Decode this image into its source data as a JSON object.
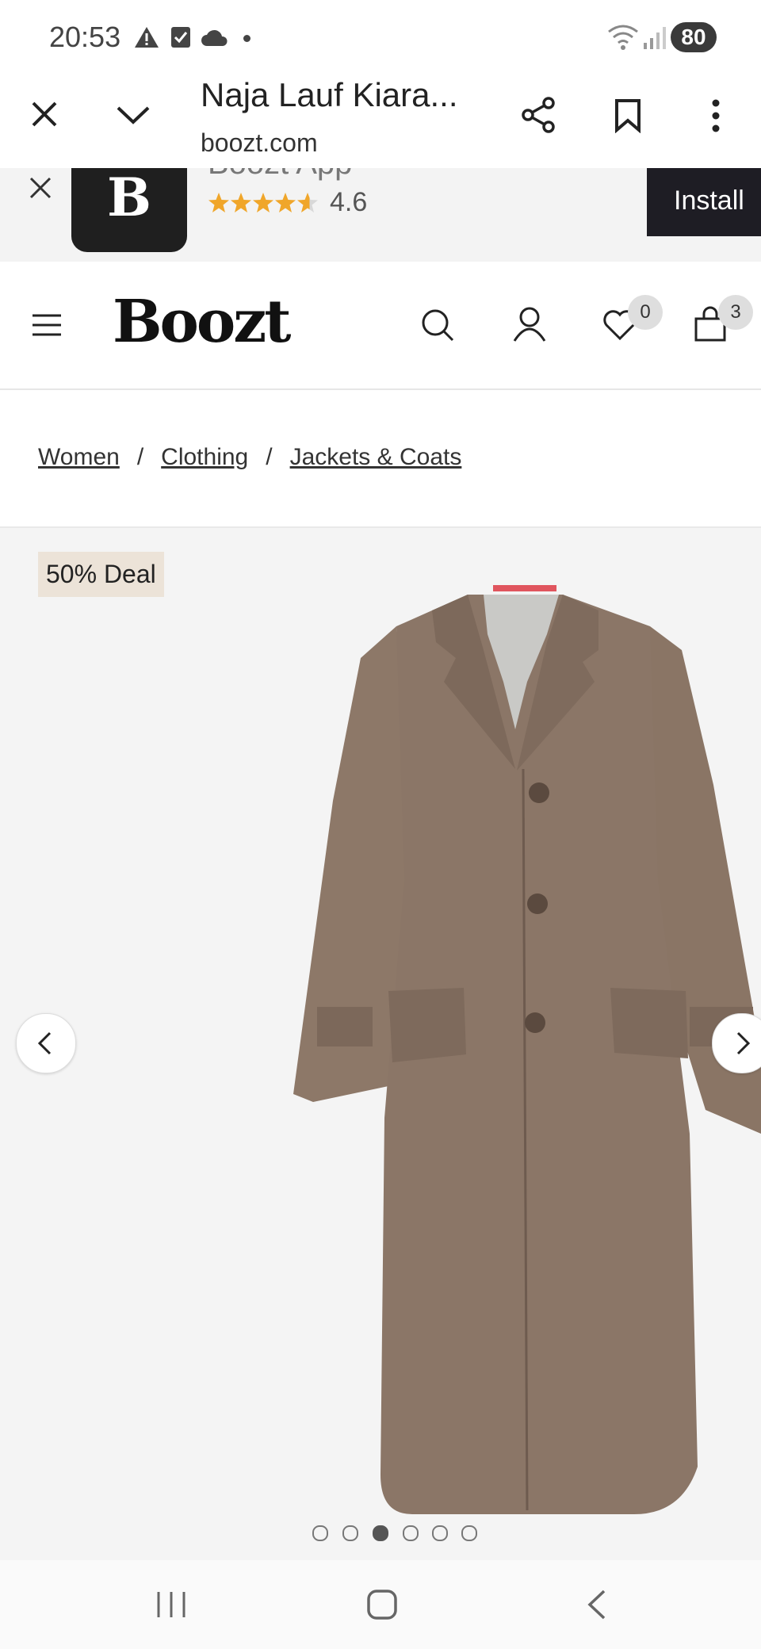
{
  "status_bar": {
    "time": "20:53",
    "battery": "80",
    "icons": [
      "alert-icon",
      "checkbox-icon",
      "cloud-icon",
      "dot-icon",
      "wifi-icon",
      "signal-icon"
    ]
  },
  "browser": {
    "title": "Naja Lauf Kiara...",
    "domain": "boozt.com",
    "icons": [
      "close-icon",
      "chevron-down-icon",
      "share-icon",
      "bookmark-icon",
      "more-vertical-icon"
    ]
  },
  "app_banner": {
    "logo_letter": "B",
    "app_name": "Boozt App",
    "rating": "4.6",
    "stars": 4.6,
    "install_label": "Install",
    "star_color": "#f0a62a"
  },
  "site_header": {
    "brand": "Boozt",
    "wishlist_count": "0",
    "cart_count": "3"
  },
  "breadcrumbs": {
    "items": [
      "Women",
      "Clothing",
      "Jackets & Coats"
    ],
    "separator": "/"
  },
  "product_gallery": {
    "deal_badge": "50% Deal",
    "image_count": 6,
    "active_index": 2,
    "coat_color": "#8b7667",
    "lining_color": "#c9c9c6"
  }
}
